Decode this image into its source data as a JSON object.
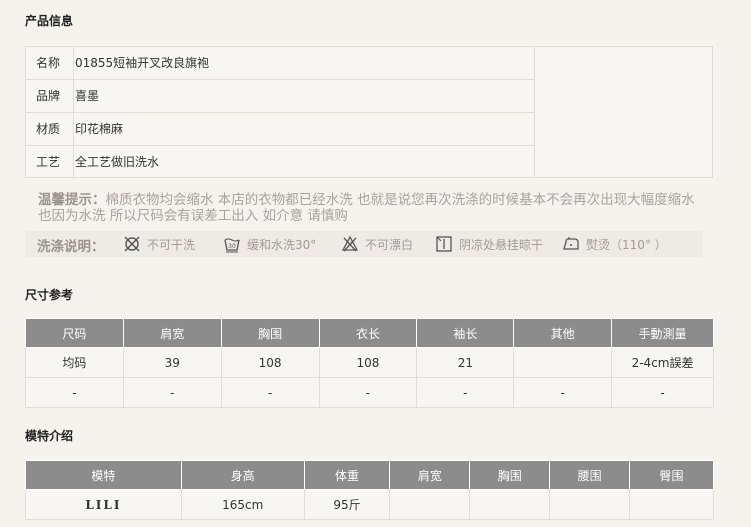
{
  "sections": {
    "product_info": "产品信息",
    "size_ref": "尺寸参考",
    "model_intro": "模特介绍"
  },
  "product_info": {
    "rows": [
      {
        "key": "名称",
        "value": "01855短袖开叉改良旗袍"
      },
      {
        "key": "品牌",
        "value": "喜墨"
      },
      {
        "key": "材质",
        "value": "印花棉麻"
      },
      {
        "key": "工艺",
        "value": "全工艺做旧洗水"
      }
    ]
  },
  "tip": {
    "label": "温馨提示：",
    "text": "棉质衣物均会缩水 本店的衣物都已经水洗 也就是说您再次洗涤的时候基本不会再次出现大幅度缩水  也因为水洗 所以尺码会有误差工出入 如介意 请慎购"
  },
  "wash": {
    "title": "洗涤说明：",
    "items": [
      {
        "icon": "no-dry-clean-icon",
        "label": "不可干洗"
      },
      {
        "icon": "gentle-wash-30-icon",
        "label": "缓和水洗30°"
      },
      {
        "icon": "no-bleach-icon",
        "label": "不可漂白"
      },
      {
        "icon": "hang-dry-shade-icon",
        "label": "阴凉处悬挂晾干"
      },
      {
        "icon": "iron-icon",
        "label": "熨烫（110°  ）"
      }
    ]
  },
  "size_table": {
    "headers": [
      "尺码",
      "肩宽",
      "胸围",
      "衣长",
      "袖长",
      "其他",
      "手動測量"
    ],
    "rows": [
      [
        "均码",
        "39",
        "108",
        "108",
        "21",
        "",
        "2-4cm誤差"
      ],
      [
        "-",
        "-",
        "-",
        "-",
        "-",
        "-",
        "-"
      ]
    ]
  },
  "model_table": {
    "headers": [
      "模特",
      "身高",
      "体重",
      "肩宽",
      "胸围",
      "腰围",
      "臀围"
    ],
    "rows": [
      [
        "LILI",
        "165cm",
        "95斤",
        "",
        "",
        "",
        ""
      ]
    ]
  },
  "colors": {
    "header_bg": "#8c8c8c",
    "page_bg": "#f6f3ee",
    "border": "#e2ddd6"
  }
}
